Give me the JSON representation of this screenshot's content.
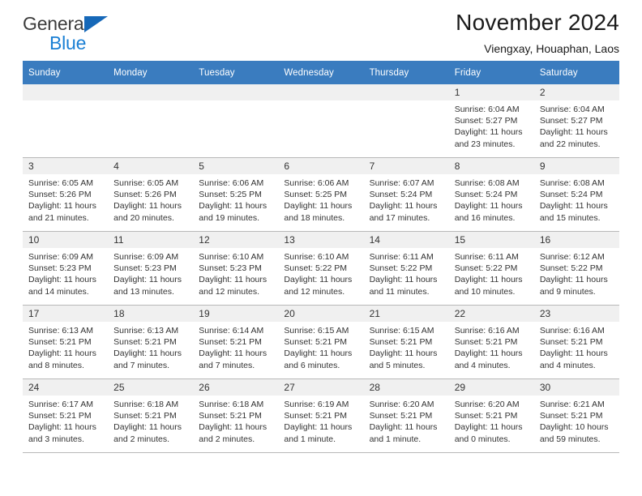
{
  "brand": {
    "word1": "General",
    "word2": "Blue",
    "triangle_color": "#1668b8",
    "blue_color": "#1a7fd4"
  },
  "header": {
    "title": "November 2024",
    "subtitle": "Viengxay, Houaphan, Laos"
  },
  "theme": {
    "header_bg": "#3a7cbf",
    "daynum_bg": "#f0f0f0",
    "grid_line": "#b8b8b8"
  },
  "labels": {
    "sunrise_prefix": "Sunrise: ",
    "sunset_prefix": "Sunset: ",
    "daylight_prefix": "Daylight: "
  },
  "weekday_headers": [
    "Sunday",
    "Monday",
    "Tuesday",
    "Wednesday",
    "Thursday",
    "Friday",
    "Saturday"
  ],
  "weeks": [
    [
      {
        "day": "",
        "sunrise": "",
        "sunset": "",
        "daylight": ""
      },
      {
        "day": "",
        "sunrise": "",
        "sunset": "",
        "daylight": ""
      },
      {
        "day": "",
        "sunrise": "",
        "sunset": "",
        "daylight": ""
      },
      {
        "day": "",
        "sunrise": "",
        "sunset": "",
        "daylight": ""
      },
      {
        "day": "",
        "sunrise": "",
        "sunset": "",
        "daylight": ""
      },
      {
        "day": "1",
        "sunrise": "Sunrise: 6:04 AM",
        "sunset": "Sunset: 5:27 PM",
        "daylight": "Daylight: 11 hours and 23 minutes."
      },
      {
        "day": "2",
        "sunrise": "Sunrise: 6:04 AM",
        "sunset": "Sunset: 5:27 PM",
        "daylight": "Daylight: 11 hours and 22 minutes."
      }
    ],
    [
      {
        "day": "3",
        "sunrise": "Sunrise: 6:05 AM",
        "sunset": "Sunset: 5:26 PM",
        "daylight": "Daylight: 11 hours and 21 minutes."
      },
      {
        "day": "4",
        "sunrise": "Sunrise: 6:05 AM",
        "sunset": "Sunset: 5:26 PM",
        "daylight": "Daylight: 11 hours and 20 minutes."
      },
      {
        "day": "5",
        "sunrise": "Sunrise: 6:06 AM",
        "sunset": "Sunset: 5:25 PM",
        "daylight": "Daylight: 11 hours and 19 minutes."
      },
      {
        "day": "6",
        "sunrise": "Sunrise: 6:06 AM",
        "sunset": "Sunset: 5:25 PM",
        "daylight": "Daylight: 11 hours and 18 minutes."
      },
      {
        "day": "7",
        "sunrise": "Sunrise: 6:07 AM",
        "sunset": "Sunset: 5:24 PM",
        "daylight": "Daylight: 11 hours and 17 minutes."
      },
      {
        "day": "8",
        "sunrise": "Sunrise: 6:08 AM",
        "sunset": "Sunset: 5:24 PM",
        "daylight": "Daylight: 11 hours and 16 minutes."
      },
      {
        "day": "9",
        "sunrise": "Sunrise: 6:08 AM",
        "sunset": "Sunset: 5:24 PM",
        "daylight": "Daylight: 11 hours and 15 minutes."
      }
    ],
    [
      {
        "day": "10",
        "sunrise": "Sunrise: 6:09 AM",
        "sunset": "Sunset: 5:23 PM",
        "daylight": "Daylight: 11 hours and 14 minutes."
      },
      {
        "day": "11",
        "sunrise": "Sunrise: 6:09 AM",
        "sunset": "Sunset: 5:23 PM",
        "daylight": "Daylight: 11 hours and 13 minutes."
      },
      {
        "day": "12",
        "sunrise": "Sunrise: 6:10 AM",
        "sunset": "Sunset: 5:23 PM",
        "daylight": "Daylight: 11 hours and 12 minutes."
      },
      {
        "day": "13",
        "sunrise": "Sunrise: 6:10 AM",
        "sunset": "Sunset: 5:22 PM",
        "daylight": "Daylight: 11 hours and 12 minutes."
      },
      {
        "day": "14",
        "sunrise": "Sunrise: 6:11 AM",
        "sunset": "Sunset: 5:22 PM",
        "daylight": "Daylight: 11 hours and 11 minutes."
      },
      {
        "day": "15",
        "sunrise": "Sunrise: 6:11 AM",
        "sunset": "Sunset: 5:22 PM",
        "daylight": "Daylight: 11 hours and 10 minutes."
      },
      {
        "day": "16",
        "sunrise": "Sunrise: 6:12 AM",
        "sunset": "Sunset: 5:22 PM",
        "daylight": "Daylight: 11 hours and 9 minutes."
      }
    ],
    [
      {
        "day": "17",
        "sunrise": "Sunrise: 6:13 AM",
        "sunset": "Sunset: 5:21 PM",
        "daylight": "Daylight: 11 hours and 8 minutes."
      },
      {
        "day": "18",
        "sunrise": "Sunrise: 6:13 AM",
        "sunset": "Sunset: 5:21 PM",
        "daylight": "Daylight: 11 hours and 7 minutes."
      },
      {
        "day": "19",
        "sunrise": "Sunrise: 6:14 AM",
        "sunset": "Sunset: 5:21 PM",
        "daylight": "Daylight: 11 hours and 7 minutes."
      },
      {
        "day": "20",
        "sunrise": "Sunrise: 6:15 AM",
        "sunset": "Sunset: 5:21 PM",
        "daylight": "Daylight: 11 hours and 6 minutes."
      },
      {
        "day": "21",
        "sunrise": "Sunrise: 6:15 AM",
        "sunset": "Sunset: 5:21 PM",
        "daylight": "Daylight: 11 hours and 5 minutes."
      },
      {
        "day": "22",
        "sunrise": "Sunrise: 6:16 AM",
        "sunset": "Sunset: 5:21 PM",
        "daylight": "Daylight: 11 hours and 4 minutes."
      },
      {
        "day": "23",
        "sunrise": "Sunrise: 6:16 AM",
        "sunset": "Sunset: 5:21 PM",
        "daylight": "Daylight: 11 hours and 4 minutes."
      }
    ],
    [
      {
        "day": "24",
        "sunrise": "Sunrise: 6:17 AM",
        "sunset": "Sunset: 5:21 PM",
        "daylight": "Daylight: 11 hours and 3 minutes."
      },
      {
        "day": "25",
        "sunrise": "Sunrise: 6:18 AM",
        "sunset": "Sunset: 5:21 PM",
        "daylight": "Daylight: 11 hours and 2 minutes."
      },
      {
        "day": "26",
        "sunrise": "Sunrise: 6:18 AM",
        "sunset": "Sunset: 5:21 PM",
        "daylight": "Daylight: 11 hours and 2 minutes."
      },
      {
        "day": "27",
        "sunrise": "Sunrise: 6:19 AM",
        "sunset": "Sunset: 5:21 PM",
        "daylight": "Daylight: 11 hours and 1 minute."
      },
      {
        "day": "28",
        "sunrise": "Sunrise: 6:20 AM",
        "sunset": "Sunset: 5:21 PM",
        "daylight": "Daylight: 11 hours and 1 minute."
      },
      {
        "day": "29",
        "sunrise": "Sunrise: 6:20 AM",
        "sunset": "Sunset: 5:21 PM",
        "daylight": "Daylight: 11 hours and 0 minutes."
      },
      {
        "day": "30",
        "sunrise": "Sunrise: 6:21 AM",
        "sunset": "Sunset: 5:21 PM",
        "daylight": "Daylight: 10 hours and 59 minutes."
      }
    ]
  ]
}
